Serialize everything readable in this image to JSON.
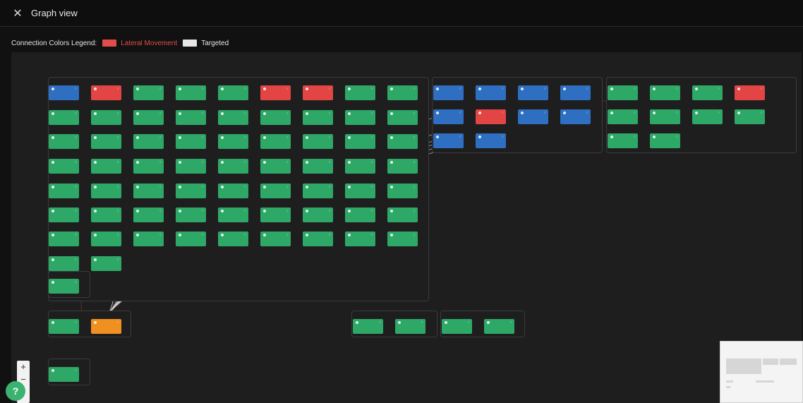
{
  "header": {
    "title": "Graph view",
    "close_icon": "close-icon"
  },
  "legend": {
    "label": "Connection Colors Legend:",
    "items": [
      {
        "name": "Lateral Movement",
        "color": "#e24c4c"
      },
      {
        "name": "Targeted",
        "color": "#e6e6e6"
      }
    ]
  },
  "colors": {
    "green": "#2ea867",
    "blue": "#2f6fc2",
    "red": "#e34545",
    "orange": "#f09020",
    "edge_lateral": "#c23a3a",
    "edge_targeted": "#cfcfcf"
  },
  "zoom": {
    "in": "+",
    "out": "−"
  },
  "help": {
    "label": "?"
  }
}
